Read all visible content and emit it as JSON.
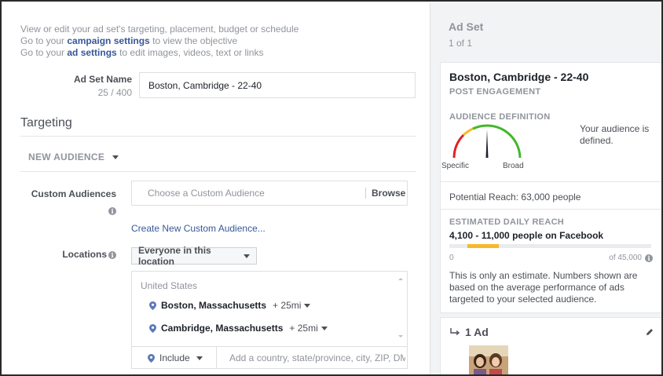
{
  "intro": {
    "line1": "View or edit your ad set's targeting, placement, budget or schedule",
    "line2_prefix": "Go to your ",
    "line2_link": "campaign settings",
    "line2_suffix": " to view the objective",
    "line3_prefix": "Go to your ",
    "line3_link": "ad settings",
    "line3_suffix": " to edit images, videos, text or links"
  },
  "adset_name": {
    "label": "Ad Set Name",
    "counter": "25 / 400",
    "value": "Boston, Cambridge - 22-40"
  },
  "targeting": {
    "title": "Targeting",
    "new_audience": "NEW AUDIENCE",
    "custom_audiences_label": "Custom Audiences",
    "custom_audiences_placeholder": "Choose a Custom Audience",
    "browse_label": "Browse",
    "create_link": "Create New Custom Audience...",
    "locations_label": "Locations",
    "location_mode": "Everyone in this location",
    "country": "United States",
    "locations": [
      {
        "name": "Boston, Massachusetts",
        "radius": "+ 25mi"
      },
      {
        "name": "Cambridge, Massachusetts",
        "radius": "+ 25mi"
      }
    ],
    "include_label": "Include",
    "add_location_placeholder": "Add a country, state/province, city, ZIP, DMA"
  },
  "side_panel": {
    "title": "Ad Set",
    "count": "1 of 1",
    "adset_name": "Boston, Cambridge - 22-40",
    "objective": "POST ENGAGEMENT",
    "audience_definition_label": "AUDIENCE DEFINITION",
    "gauge_specific": "Specific",
    "gauge_broad": "Broad",
    "gauge_level": 0.5,
    "audience_message": "Your audience is defined.",
    "potential_reach": "Potential Reach: 63,000 people",
    "daily_reach_label": "ESTIMATED DAILY REACH",
    "daily_reach_value": "4,100 - 11,000 people on Facebook",
    "daily_reach_min": 4100,
    "daily_reach_max": 11000,
    "scale_min_label": "0",
    "scale_max_label": "of 45,000",
    "scale_max": 45000,
    "estimate_note": "This is only an estimate. Numbers shown are based on the average performance of ads targeted to your selected audience.",
    "ads_title": "1 Ad"
  },
  "colors": {
    "link": "#365899",
    "gauge_red": "#e02020",
    "gauge_green": "#42b72a",
    "gauge_yellow": "#f7b928",
    "reach_bar": "#f7b928",
    "pin": "#5b7bb5"
  }
}
